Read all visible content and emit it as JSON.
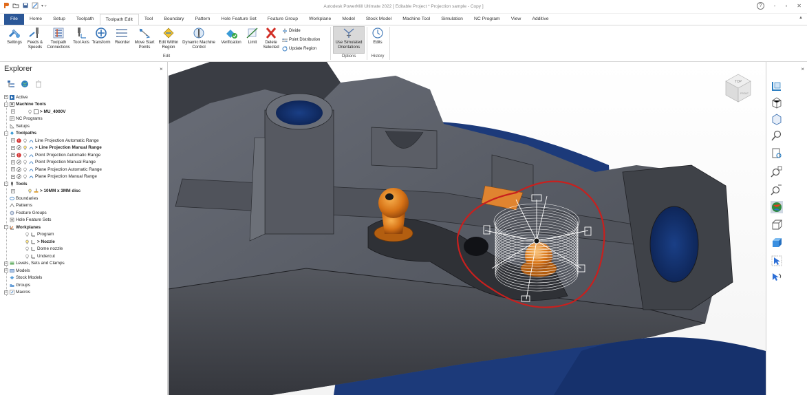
{
  "window": {
    "title": "Autodesk PowerMill Ultimate 2022   [ Editable Project * Projection sample - Copy ]",
    "help": "?",
    "minimize": "-",
    "restore": "▫",
    "close": "✕"
  },
  "tabs": [
    "File",
    "Home",
    "Setup",
    "Toolpath",
    "Toolpath Edit",
    "Tool",
    "Boundary",
    "Pattern",
    "Hole Feature Set",
    "Feature Group",
    "Workplane",
    "Model",
    "Stock Model",
    "Machine Tool",
    "Simulation",
    "NC Program",
    "View",
    "Additive"
  ],
  "active_tab": "Toolpath Edit",
  "ribbon": {
    "buttons": {
      "settings": "Settings",
      "feeds_speeds": "Feeds & Speeds",
      "toolpath_connections": "Toolpath Connections",
      "tool_axis": "Tool Axis",
      "transform": "Transform",
      "reorder": "Reorder",
      "move_start_points": "Move Start Points",
      "edit_within_region": "Edit Within Region",
      "dynamic_machine_control": "Dynamic Machine Control",
      "verification": "Verification",
      "limit": "Limit",
      "delete_selected": "Delete Selected",
      "divide": "Divide",
      "point_distribution": "Point Distribution",
      "update_region": "Update Region",
      "use_simulated_orientations": "Use Simulated Orientations",
      "edits": "Edits"
    },
    "groups": {
      "edit": "Edit",
      "options": "Options",
      "history": "History"
    }
  },
  "explorer": {
    "title": "Explorer",
    "close": "×",
    "tree": {
      "active": "Active",
      "machine_tools": "Machine Tools",
      "machine_tool_item": "> MU_4000V",
      "nc_programs": "NC Programs",
      "setups": "Setups",
      "toolpaths": "Toolpaths",
      "toolpath_items": [
        "Line Projection Automatic Range",
        "> Line Projection Manual Range",
        "Point Projection Automatic Range",
        "Point Projection Manual Range",
        "Plane Projection Automatic Range",
        "Plane Projection Manual Range"
      ],
      "tools": "Tools",
      "tool_item": "> 10MM x 3MM disc",
      "boundaries": "Boundaries",
      "patterns": "Patterns",
      "feature_groups": "Feature Groups",
      "hole_feature_sets": "Hole Feature Sets",
      "workplanes": "Workplanes",
      "workplane_items": [
        "Program",
        "> Nozzle",
        "Dome nozzle",
        "Undercut"
      ],
      "levels": "Levels, Sets and Clamps",
      "models": "Models",
      "stock_models": "Stock Models",
      "groups": "Groups",
      "macros": "Macros"
    }
  },
  "viewcube": {
    "top": "TOP",
    "front": "FRONT"
  },
  "right_toolbar": {
    "close": "×"
  },
  "colors": {
    "file_tab": "#2b5797",
    "part": "#3e4149",
    "orange": "#e07b21",
    "annotation": "#c8201e",
    "stock": "#1c3a7a"
  }
}
